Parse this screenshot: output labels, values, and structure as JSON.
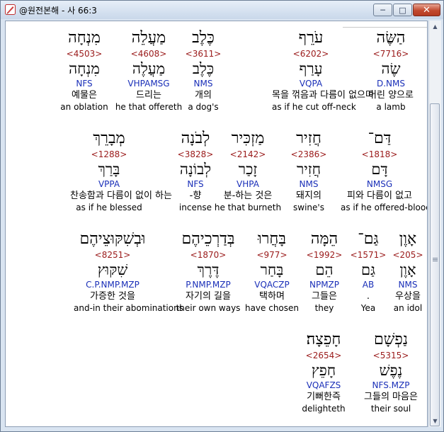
{
  "window": {
    "title": "@원전본해 - 사 66:3",
    "minimize_glyph": "─",
    "maximize_glyph": "□",
    "close_glyph": "✕",
    "app_icon": "pen-logo-icon"
  },
  "verse_rows": [
    [
      {
        "hebrew": "הַשֶּׂה",
        "strong": "<7716>",
        "lemma": "שֶׂה",
        "morph": "D.NMS",
        "korean": "어린 양으로",
        "english": "a lamb"
      },
      {
        "hebrew": "עֹרֵף",
        "strong": "<6202>",
        "lemma": "עָרַף",
        "morph": "VQPA",
        "korean": "목을 꺾음과 다름이 없으며",
        "english": "as if he cut off-neck"
      },
      {
        "hebrew": "כֶּלֶב",
        "strong": "<3611>",
        "lemma": "כֶּלֶב",
        "morph": "NMS",
        "korean": "개의",
        "english": "a dog's"
      },
      {
        "hebrew": "מַעֲלֵה",
        "strong": "<4608>",
        "lemma": "מַעֲלֶה",
        "morph": "VHPAMSG",
        "korean": "드리는",
        "english": "he that offereth"
      },
      {
        "hebrew": "מִנְחָה",
        "strong": "<4503>",
        "lemma": "מִנְחָה",
        "morph": "NFS",
        "korean": "예물은",
        "english": "an oblation"
      }
    ],
    [
      {
        "hebrew": "דַּם־",
        "strong": "<1818>",
        "lemma": "דָּם",
        "morph": "NMSG",
        "korean": "피와 다름이 없고",
        "english": "as if he offered-blood"
      },
      {
        "hebrew": "חֲזִיר",
        "strong": "<2386>",
        "lemma": "חֲזִיר",
        "morph": "NMS",
        "korean": "돼지의",
        "english": "swine's"
      },
      {
        "hebrew": "מַזְכִּיר",
        "strong": "<2142>",
        "lemma": "זָכַר",
        "morph": "VHPA",
        "korean": "분-하는 것은",
        "english": "he that burneth"
      },
      {
        "hebrew": "לְבֹנָה",
        "strong": "<3828>",
        "lemma": "לְבוֹנָה",
        "morph": "NFS",
        "korean": "-향",
        "english": "incense"
      },
      {
        "hebrew": "מְבָרֵךְ",
        "strong": "<1288>",
        "lemma": "בָּרַךְ",
        "morph": "VPPA",
        "korean": "찬송함과 다름이 없이 하는",
        "english": "as if he blessed"
      }
    ],
    [
      {
        "hebrew": "אָוֶן",
        "strong": "<205>",
        "lemma": "אָוֶן",
        "morph": "NMS",
        "korean": "우상을",
        "english": "an idol"
      },
      {
        "hebrew": "גַּם־",
        "strong": "<1571>",
        "lemma": "גַּם",
        "morph": "AB",
        "korean": ".",
        "english": "Yea"
      },
      {
        "hebrew": "הֵמָּה",
        "strong": "<1992>",
        "lemma": "הֵם",
        "morph": "NPMZP",
        "korean": "그들은",
        "english": "they"
      },
      {
        "hebrew": "בָּחֲרוּ",
        "strong": "<977>",
        "lemma": "בָּחַר",
        "morph": "VQACZP",
        "korean": "택하며",
        "english": "have chosen"
      },
      {
        "hebrew": "בְּדַרְכֵיהֶם",
        "strong": "<1870>",
        "lemma": "דֶּרֶךְ",
        "morph": "P.NMP.MZP",
        "korean": "자기의 길을",
        "english": "their own ways"
      },
      {
        "hebrew": "וּבְשִׁקּוּצֵיהֶם",
        "strong": "<8251>",
        "lemma": "שִׁקּוּץ",
        "morph": "C.P.NMP.MZP",
        "korean": "가증한 것을",
        "english": "and-in their abominations"
      }
    ],
    [
      {
        "hebrew": "נַפְשָׁם",
        "strong": "<5315>",
        "lemma": "נֶפֶשׁ",
        "morph": "NFS.MZP",
        "korean": "그들의 마음은",
        "english": "their soul"
      },
      {
        "hebrew": "חָפֵצָה׃",
        "strong": "<2654>",
        "lemma": "חָפֵץ",
        "morph": "VQAFZS",
        "korean": "기뻐한즉",
        "english": "delighteth"
      }
    ]
  ]
}
